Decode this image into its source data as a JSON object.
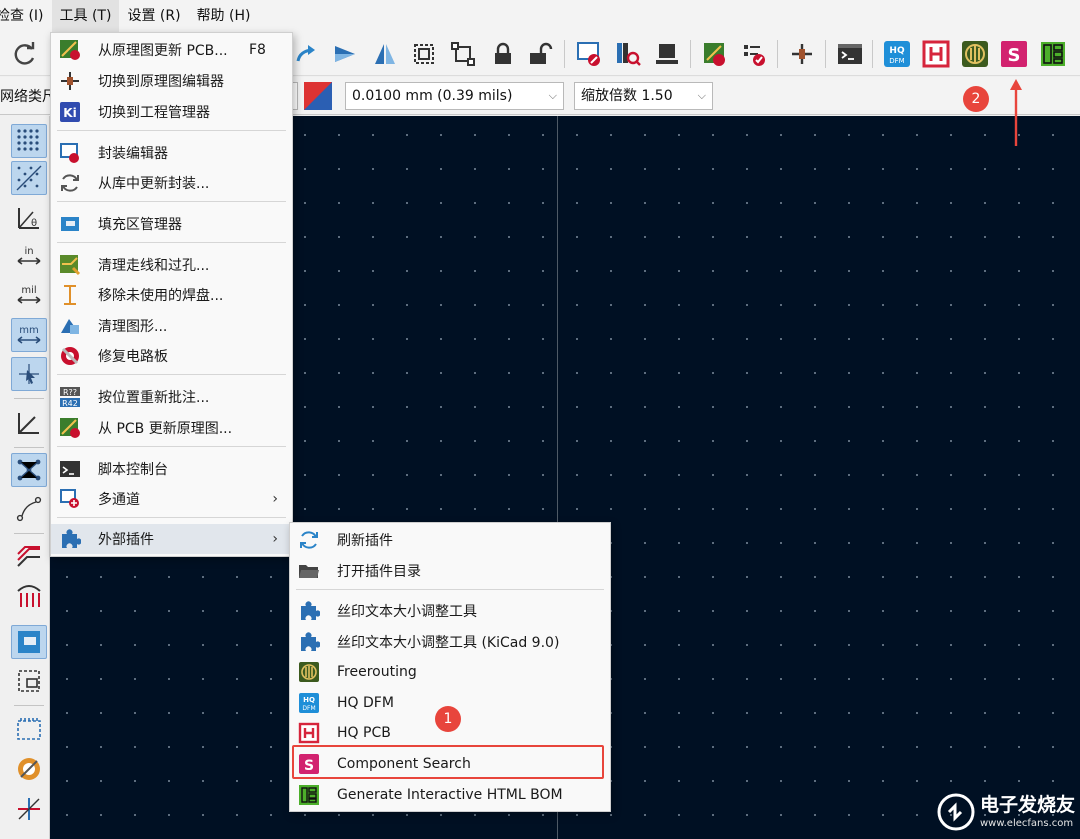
{
  "menubar": {
    "items": [
      "检查 (I)",
      "工具 (T)",
      "设置 (R)",
      "帮助 (H)"
    ]
  },
  "toolbar2": {
    "left_label": "网络类尺",
    "grid_value": "0.0100 mm (0.39 mils)",
    "zoom_value": "缩放倍数 1.50"
  },
  "tools_menu": {
    "items": [
      {
        "label": "从原理图更新 PCB...",
        "shortcut": "F8",
        "icon": "update-pcb-icon"
      },
      {
        "label": "切换到原理图编辑器",
        "icon": "schematic-icon"
      },
      {
        "label": "切换到工程管理器",
        "icon": "kicad-icon"
      },
      {
        "label": "封装编辑器",
        "icon": "footprint-editor-icon"
      },
      {
        "label": "从库中更新封装...",
        "icon": "refresh-icon"
      },
      {
        "label": "填充区管理器",
        "icon": "zone-icon"
      },
      {
        "label": "清理走线和过孔...",
        "icon": "cleanup-tracks-icon"
      },
      {
        "label": "移除未使用的焊盘...",
        "icon": "remove-pads-icon"
      },
      {
        "label": "清理图形...",
        "icon": "cleanup-graphics-icon"
      },
      {
        "label": "修复电路板",
        "icon": "repair-icon"
      },
      {
        "label": "按位置重新批注...",
        "icon": "reannotate-icon"
      },
      {
        "label": "从 PCB 更新原理图...",
        "icon": "update-schematic-icon"
      },
      {
        "label": "脚本控制台",
        "icon": "console-icon"
      },
      {
        "label": "多通道",
        "icon": "multichannel-icon",
        "submenu": "›"
      },
      {
        "label": "外部插件",
        "icon": "plugin-icon",
        "submenu": "›"
      }
    ]
  },
  "plugins_menu": {
    "items": [
      {
        "label": "刷新插件",
        "icon": "refresh-icon"
      },
      {
        "label": "打开插件目录",
        "icon": "folder-icon"
      },
      {
        "label": "丝印文本大小调整工具",
        "icon": "plugin-icon"
      },
      {
        "label": "丝印文本大小调整工具 (KiCad 9.0)",
        "icon": "plugin-icon"
      },
      {
        "label": "Freerouting",
        "icon": "freerouting-icon"
      },
      {
        "label": "HQ DFM",
        "icon": "hq-dfm-icon"
      },
      {
        "label": "HQ PCB",
        "icon": "hq-pcb-icon"
      },
      {
        "label": "Component Search",
        "icon": "component-search-icon"
      },
      {
        "label": "Generate Interactive HTML BOM",
        "icon": "ibom-icon"
      }
    ]
  },
  "annotations": {
    "badge1": "1",
    "badge2": "2"
  },
  "watermark": {
    "title": "电子发烧友",
    "url": "www.elecfans.com"
  },
  "colors": {
    "canvas_bg": "#001023",
    "accent_red": "#e8453c",
    "highlight_box": "#e8453c"
  }
}
